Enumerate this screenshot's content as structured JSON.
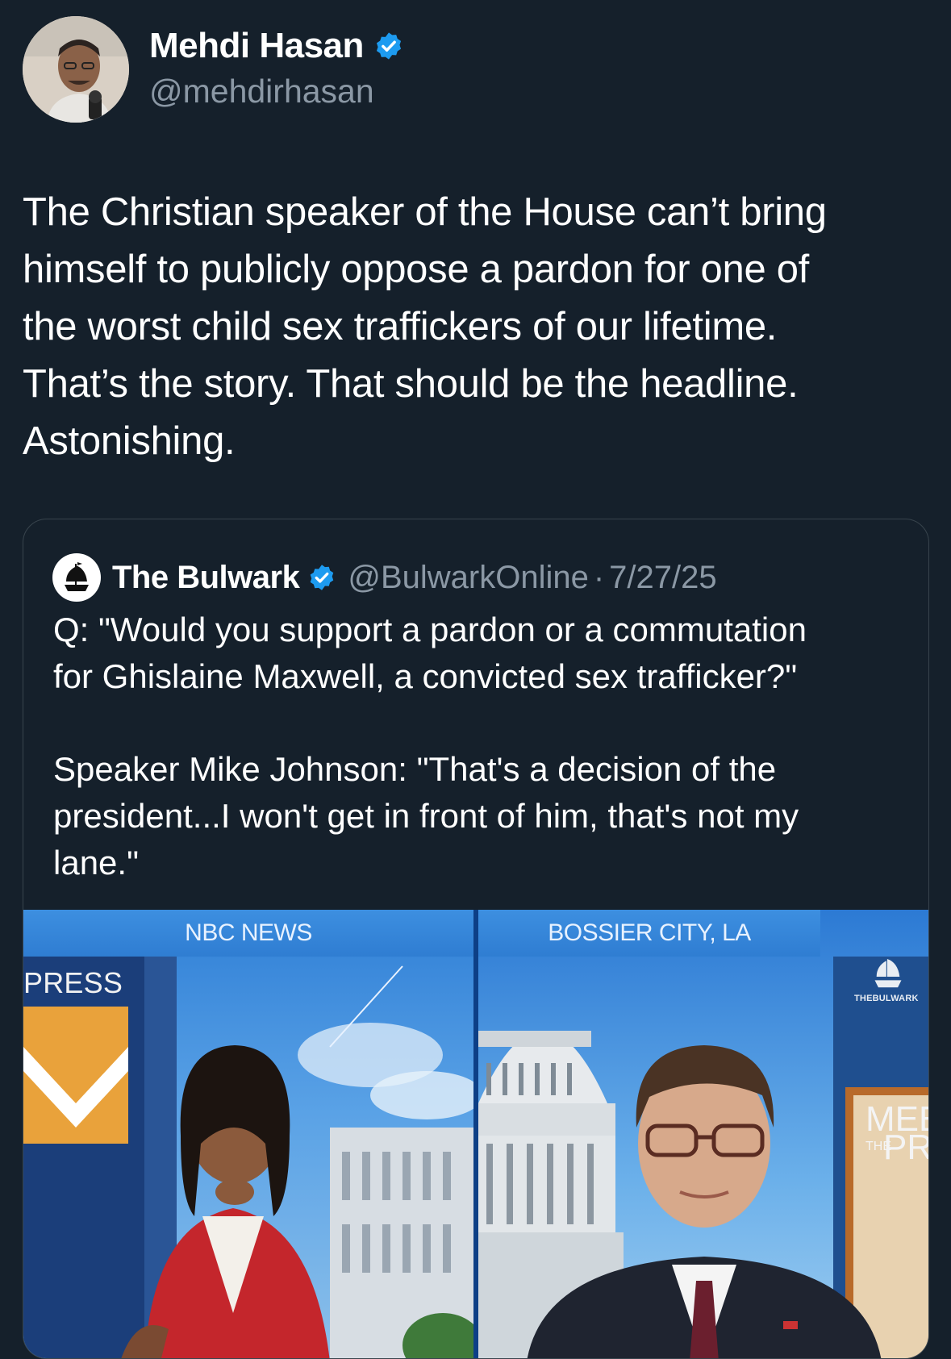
{
  "author": {
    "name": "Mehdi Hasan",
    "handle": "@mehdirhasan",
    "verified_icon": "verified-badge-icon",
    "accent": "#1d9bf0"
  },
  "tweet": {
    "lines": [
      "The Christian speaker of the House can’t bring",
      "himself to publicly oppose a pardon for one of",
      "the worst child sex traffickers of our lifetime.",
      "That’s the story. That should be the headline.",
      "Astonishing."
    ]
  },
  "quote": {
    "name": "The Bulwark",
    "handle": "@BulwarkOnline",
    "separator": "·",
    "date": "7/27/25",
    "paragraph1": [
      "Q: \"Would you support a pardon or a commutation",
      "for Ghislaine Maxwell, a convicted sex trafficker?\""
    ],
    "paragraph2": [
      "Speaker Mike Johnson: \"That's a decision of the",
      "president...I won't get in front of him, that's not my",
      "lane.\""
    ]
  },
  "video": {
    "left_label": "NBC NEWS",
    "right_label": "BOSSIER CITY, LA",
    "left_set_text": "PRESS",
    "watermark": "THEBULWARK",
    "right_set_text_1": "MEE",
    "right_set_text_2": "THE",
    "right_set_text_3": "PR"
  }
}
